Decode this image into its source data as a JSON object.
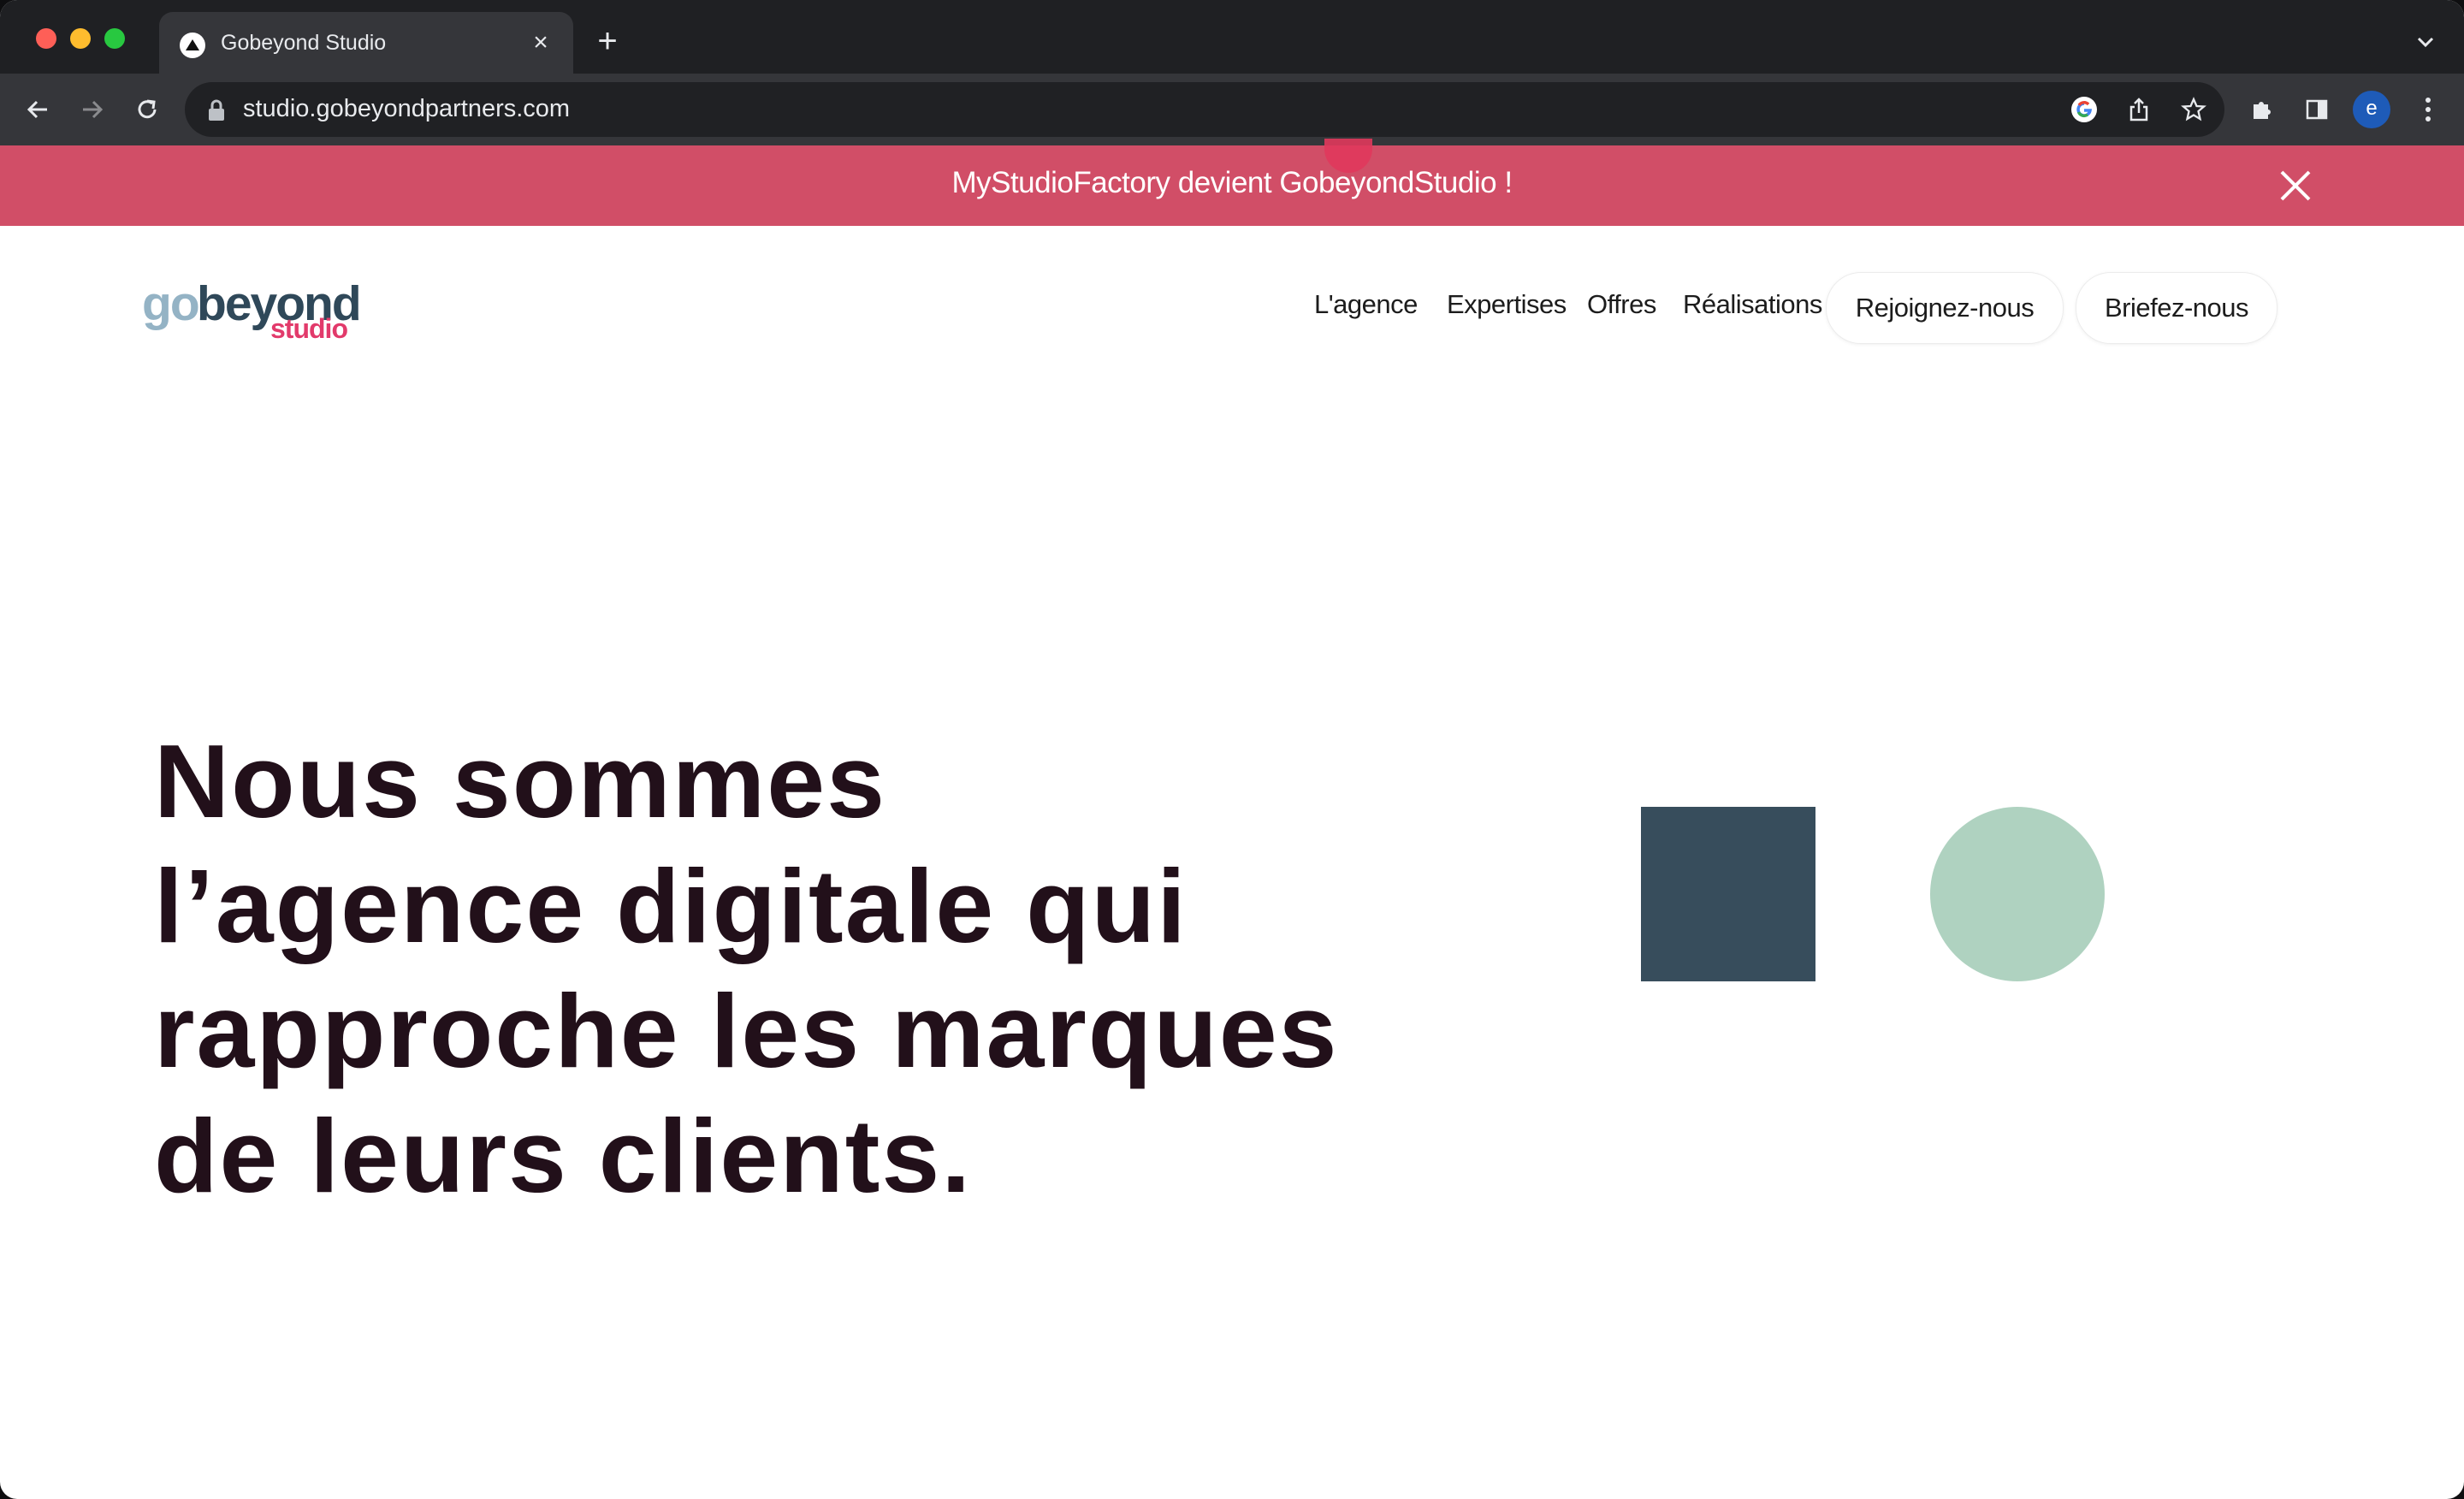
{
  "browser": {
    "tab_title": "Gobeyond Studio",
    "url": "studio.gobeyondpartners.com",
    "profile_initial": "e"
  },
  "announcement": {
    "text": "MyStudioFactory devient GobeyondStudio !"
  },
  "logo": {
    "part1": "go",
    "part2": "beyond",
    "part3": "studio"
  },
  "nav": {
    "links": [
      "L'agence",
      "Expertises",
      "Offres",
      "Réalisations"
    ],
    "join_label": "Rejoignez-nous",
    "brief_label": "Briefez-nous"
  },
  "hero": {
    "lines": [
      "Nous sommes",
      "l’agence digitale qui",
      "rapproche les marques",
      "de leurs clients."
    ]
  },
  "colors": {
    "banner": "#d14e67",
    "square": "#374d5c",
    "circle": "#afd2c0",
    "heading": "#22101a"
  }
}
